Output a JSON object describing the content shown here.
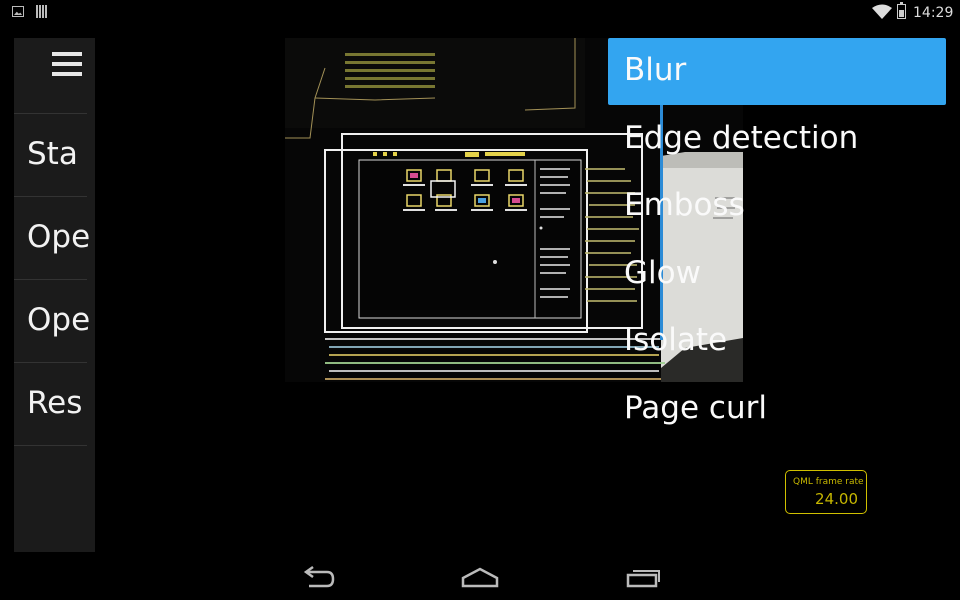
{
  "status_bar": {
    "time": "14:29",
    "icons": [
      "image-notification-icon",
      "barcode-notification-icon",
      "wifi-icon",
      "battery-icon"
    ]
  },
  "side_panel": {
    "menu_icon": "hamburger-menu-icon",
    "items": [
      {
        "label": "Sta"
      },
      {
        "label": "Ope"
      },
      {
        "label": "Ope"
      },
      {
        "label": "Res"
      }
    ]
  },
  "effects_menu": {
    "items": [
      {
        "label": "Blur",
        "selected": true
      },
      {
        "label": "Edge detection",
        "selected": false
      },
      {
        "label": "Emboss",
        "selected": false
      },
      {
        "label": "Glow",
        "selected": false
      },
      {
        "label": "Isolate",
        "selected": false
      },
      {
        "label": "Page curl",
        "selected": false
      }
    ],
    "accent_color": "#33a5f0"
  },
  "frame_rate": {
    "label": "QML frame rate",
    "value": "24.00",
    "color": "#c6b700"
  },
  "nav_bar": {
    "buttons": [
      "back-icon",
      "home-icon",
      "recent-apps-icon"
    ]
  }
}
